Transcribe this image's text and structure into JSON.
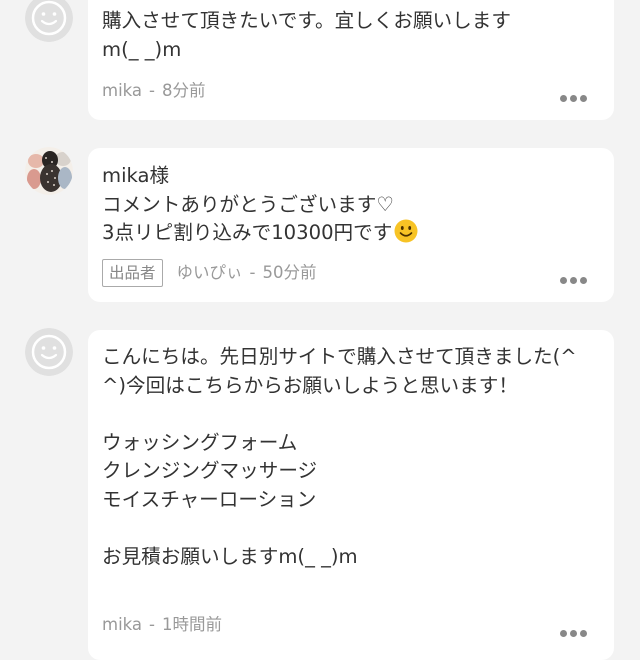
{
  "comments": [
    {
      "text": "購入させて頂きたいです。宜しくお願いします\nm(_ _)m",
      "author": "mika",
      "separator": "-",
      "time": "8分前",
      "avatar": "default-avatar-icon",
      "more": "more-options-icon"
    },
    {
      "text": "mika様\nコメントありがとうございます♡\n3点リピ割り込みで10300円です",
      "emoji": "smiling-face-emoji",
      "badge": "出品者",
      "author": "ゆいぴぃ",
      "separator": "-",
      "time": "50分前",
      "avatar": "seller-avatar-image",
      "more": "more-options-icon"
    },
    {
      "text": "こんにちは。先日別サイトで購入させて頂きました(^^)今回はこちらからお願いしようと思います！\n\nウォッシングフォーム\nクレンジングマッサージ\nモイスチャーローション\n\nお見積お願いしますm(_ _)m",
      "author": "mika",
      "separator": "-",
      "time": "1時間前",
      "avatar": "default-avatar-icon",
      "more": "more-options-icon"
    }
  ],
  "colors": {
    "background": "#f3f3f3",
    "bubble": "#ffffff",
    "text": "#333333",
    "meta": "#999999",
    "dots": "#888888",
    "emoji": "#f7c325"
  }
}
